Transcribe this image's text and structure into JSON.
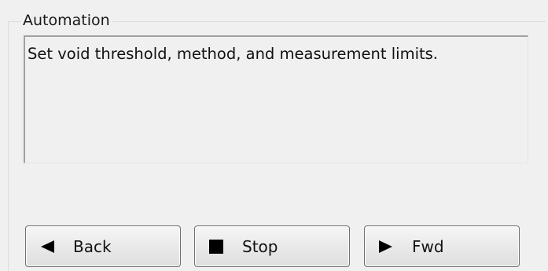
{
  "group": {
    "title": "Automation"
  },
  "description": {
    "text": "Set void threshold, method, and measurement limits."
  },
  "buttons": {
    "back": {
      "label": "Back",
      "icon": "triangle-left-icon"
    },
    "stop": {
      "label": "Stop",
      "icon": "square-stop-icon"
    },
    "fwd": {
      "label": "Fwd",
      "icon": "triangle-right-icon"
    }
  },
  "colors": {
    "panel_bg": "#f0f0f0",
    "button_border": "#707070",
    "icon": "#000000"
  }
}
